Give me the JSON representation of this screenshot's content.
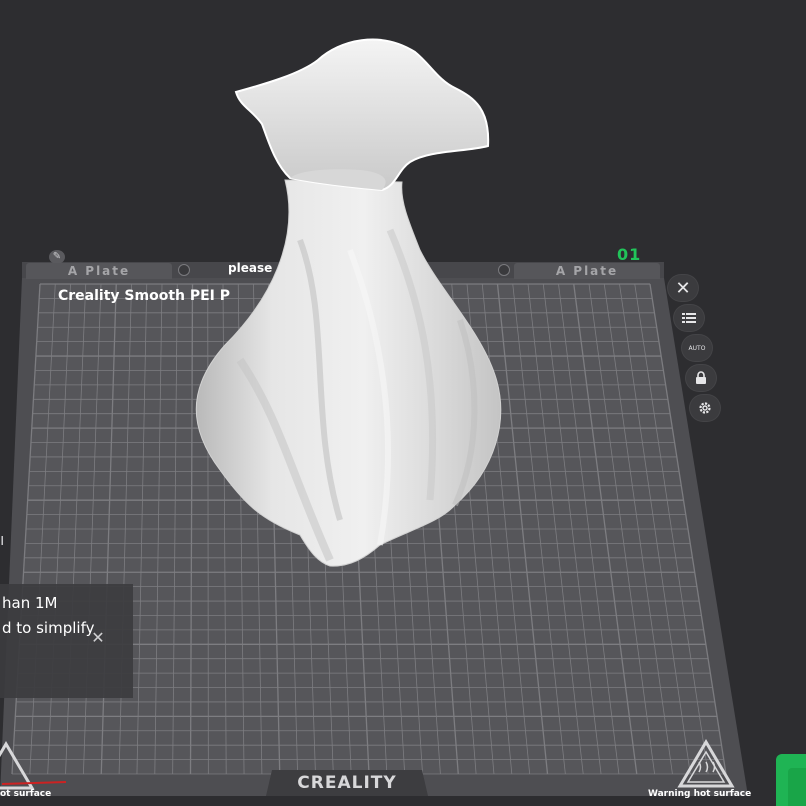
{
  "plate": {
    "tab_left_label": "A Plate",
    "tab_right_label": "A Plate",
    "center_text": "please",
    "number": "01",
    "bed_name": "Creality Smooth PEI P"
  },
  "toast": {
    "line1": "han 1M",
    "line2": "d to simplify",
    "close_glyph": "✕",
    "edge_glyph": "ı"
  },
  "bed": {
    "brand": "CREALITY",
    "warning_left": "ot surface",
    "warning_right": "Warning hot surface"
  },
  "toolbar": {
    "close_glyph": "✕",
    "auto_label": "AUTO"
  },
  "colors": {
    "background": "#2d2d30",
    "bed": "#4e4e52",
    "grid": "#8a8a8e",
    "accent": "#21c45a",
    "model": "#e6e6e6"
  },
  "icons": [
    "pencil-icon",
    "close-icon",
    "list-icon",
    "auto-arrange-icon",
    "lock-icon",
    "gear-icon",
    "hot-surface-warning-icon"
  ]
}
